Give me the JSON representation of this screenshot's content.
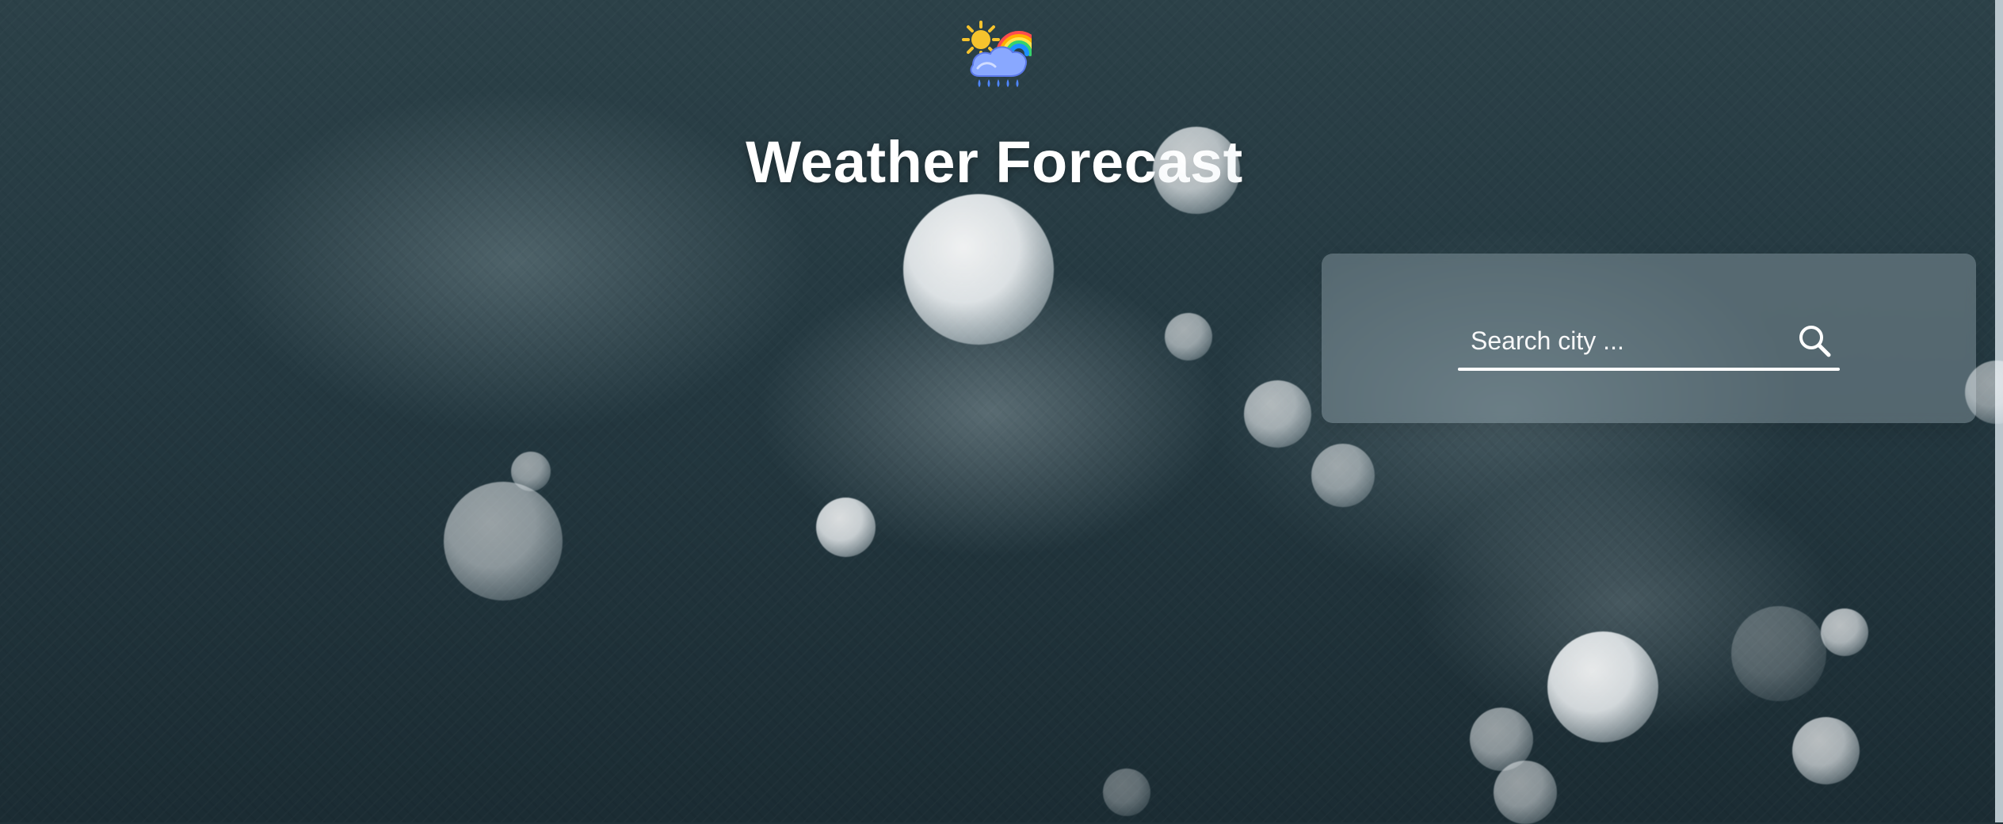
{
  "app": {
    "title": "Weather Forecast"
  },
  "header": {
    "logo_icon": "sun-cloud-rainbow-icon"
  },
  "search": {
    "placeholder": "Search city ...",
    "value": "",
    "button_icon": "search-icon"
  },
  "theme": {
    "text_color": "#ffffff",
    "accent": "#ffffff"
  }
}
